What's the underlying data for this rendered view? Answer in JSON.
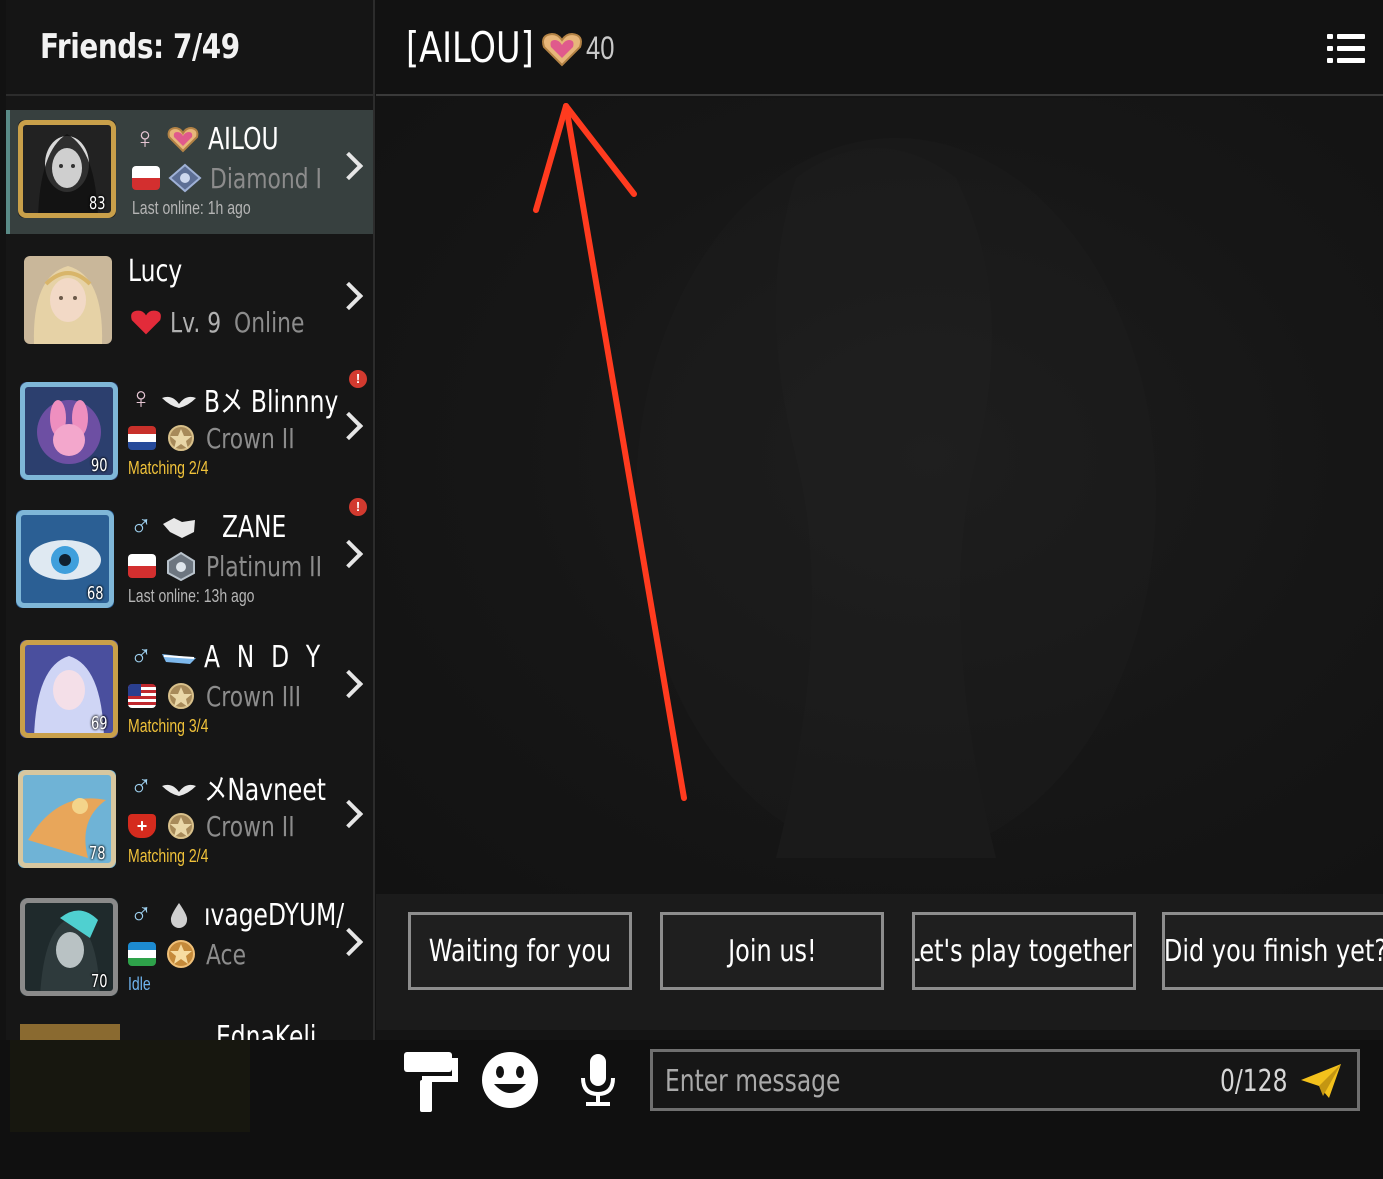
{
  "friends_panel": {
    "title": "Friends: 7/49",
    "friends": [
      {
        "name": "AILOU",
        "gender": "female",
        "level": "83",
        "rank": "Diamond I",
        "status": "Last online: 1h ago",
        "status_color": "gray",
        "selected": true,
        "notify": false
      },
      {
        "name": "Lucy",
        "gender": "",
        "level": "",
        "rank": "Lv. 9",
        "rank_extra": "Online",
        "status": "",
        "selected": false,
        "notify": false
      },
      {
        "name": "Bメ Blinnny",
        "gender": "female",
        "level": "90",
        "rank": "Crown II",
        "status": "Matching 2/4",
        "status_color": "yellow",
        "selected": false,
        "notify": true
      },
      {
        "name": "ZANE",
        "gender": "male",
        "level": "68",
        "rank": "Platinum II",
        "status": "Last online: 13h ago",
        "status_color": "gray",
        "selected": false,
        "notify": true
      },
      {
        "name": "A N D Y",
        "gender": "male",
        "level": "69",
        "rank": "Crown III",
        "status": "Matching 3/4",
        "status_color": "yellow",
        "selected": false,
        "notify": false
      },
      {
        "name": "メNavneet",
        "gender": "male",
        "level": "78",
        "rank": "Crown II",
        "status": "Matching 2/4",
        "status_color": "yellow",
        "selected": false,
        "notify": false
      },
      {
        "name": "ıvageDYUM/",
        "gender": "male",
        "level": "70",
        "rank": "Ace",
        "status": "Idle",
        "status_color": "blue",
        "selected": false,
        "notify": false
      },
      {
        "name": "EdnaKeli",
        "gender": "",
        "level": "",
        "rank": "",
        "status": "",
        "selected": false,
        "notify": false
      }
    ]
  },
  "chat": {
    "title": "[AILOU]",
    "intimacy": "40",
    "quick_replies": [
      "Waiting for you",
      "Join us!",
      "Let's play together!",
      "Did you finish yet?"
    ],
    "input_placeholder": "Enter message",
    "char_count": "0/128"
  },
  "icons": [
    "menu-icon",
    "paint-roller-icon",
    "emoji-icon",
    "microphone-icon",
    "send-icon",
    "heart-icon",
    "chevron-right-icon"
  ],
  "colors": {
    "accent_yellow": "#f0c23a",
    "selected_row": "#37403f",
    "arrow_annotation": "#ff3b1f"
  }
}
